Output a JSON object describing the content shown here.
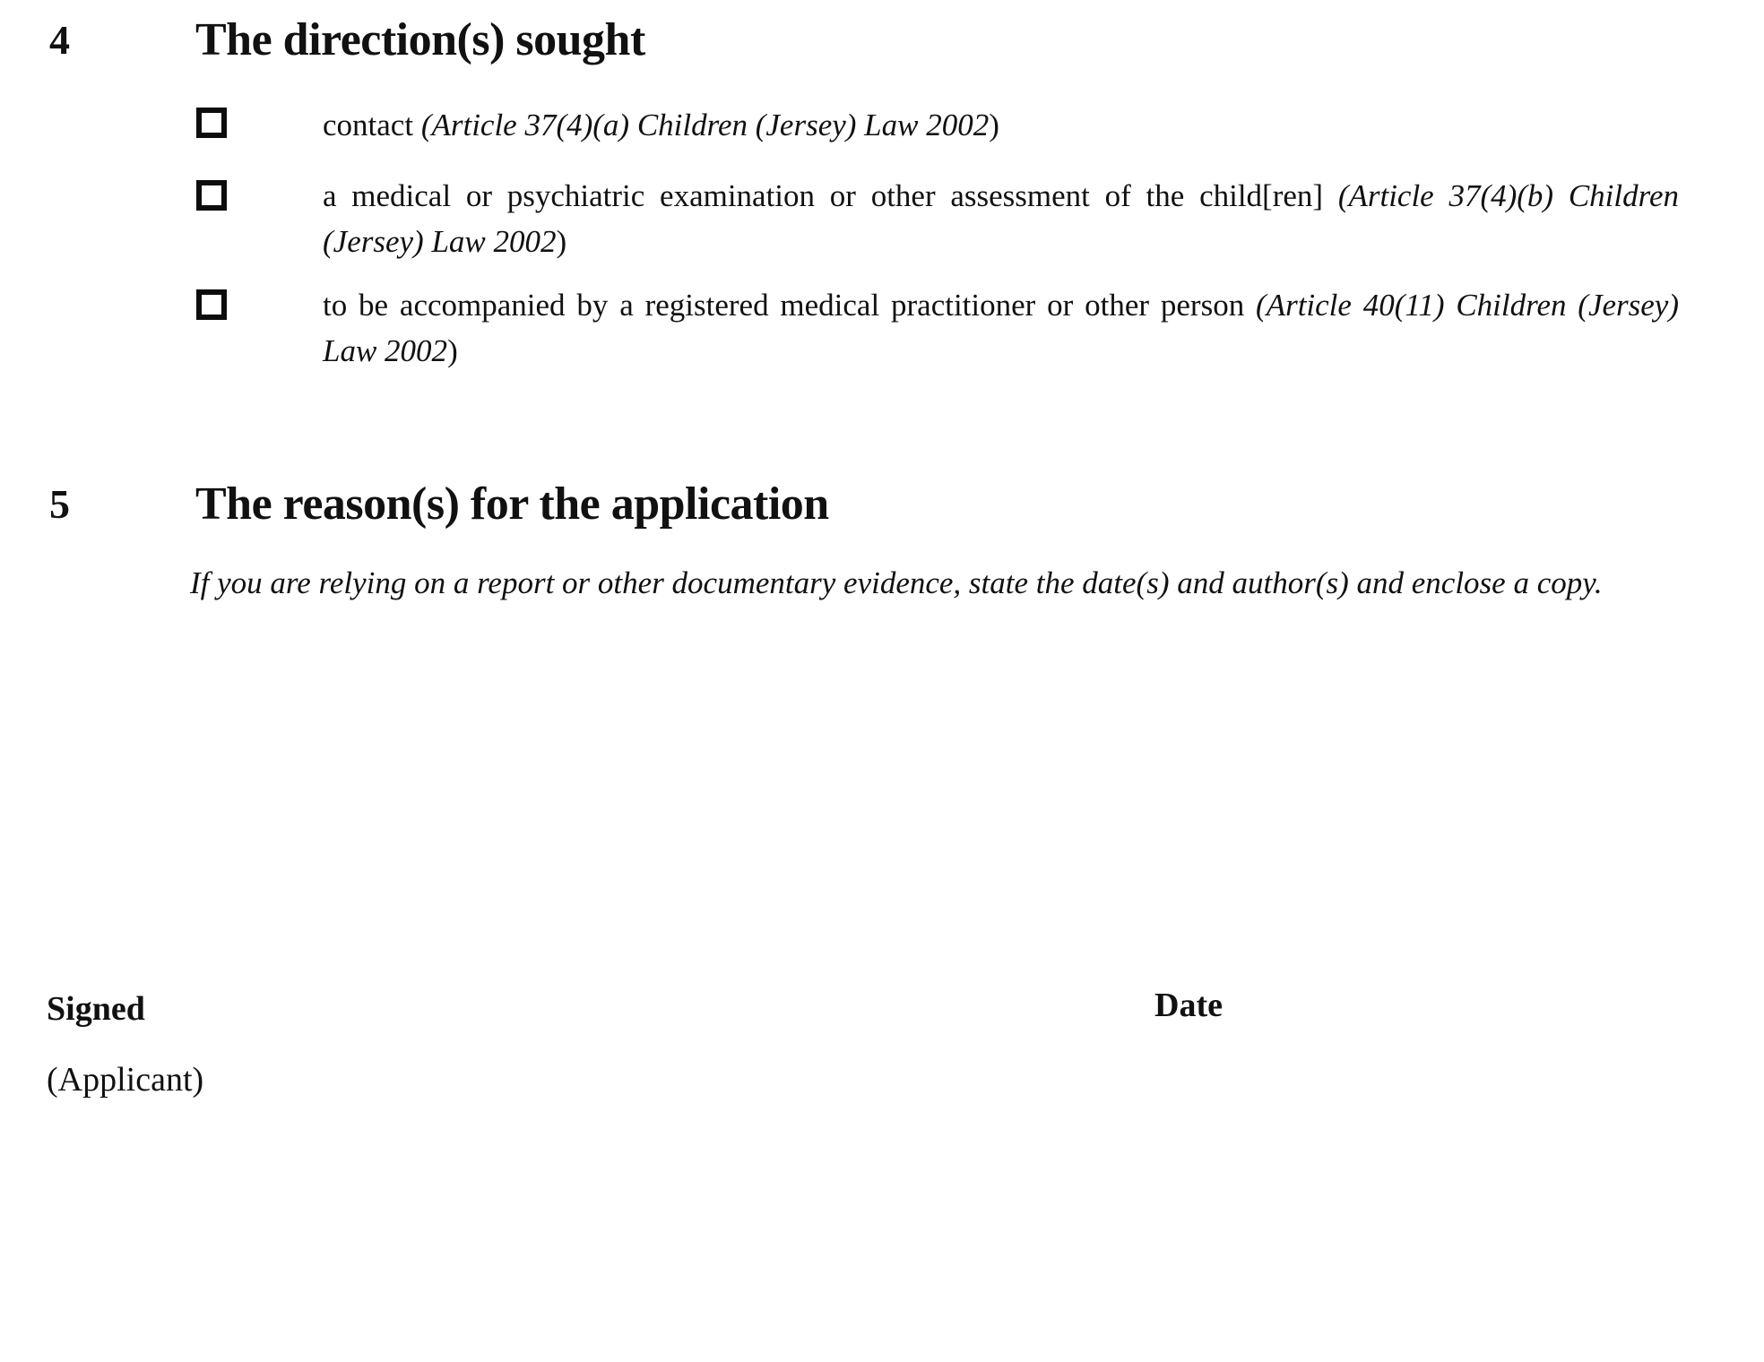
{
  "document": {
    "sections": [
      {
        "number": "4",
        "title": "The direction(s) sought",
        "items": [
          {
            "checkbox_name": "checkbox-contact",
            "text_plain": "contact ",
            "text_italic": "(Article 37(4)(a) Children (Jersey) Law 2002",
            "text_tail": ")"
          },
          {
            "checkbox_name": "checkbox-medical-examination",
            "text_plain": "a medical or psychiatric examination or other assessment of the child[ren] ",
            "text_italic": "(Article 37(4)(b) Children (Jersey) Law 2002",
            "text_tail": ")"
          },
          {
            "checkbox_name": "checkbox-accompanied-by-practitioner",
            "text_plain": "to be accompanied by a registered medical practitioner or other person ",
            "text_italic": "(Article 40(11) Children (Jersey) Law 2002",
            "text_tail": ")"
          }
        ]
      },
      {
        "number": "5",
        "title": "The reason(s) for the application",
        "instruction": "If you are relying on a report or other documentary evidence, state the date(s) and author(s) and enclose a copy."
      }
    ],
    "signature_block": {
      "signed_label": "Signed",
      "applicant_label": "(Applicant)",
      "date_label": "Date"
    }
  }
}
